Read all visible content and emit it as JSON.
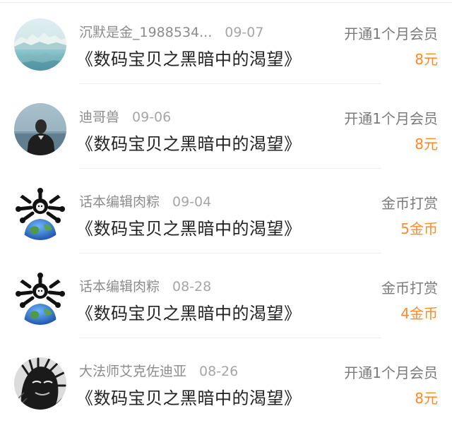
{
  "records": [
    {
      "username": "沉默是金_1988534...",
      "date": "09-07",
      "title": "《数码宝贝之黑暗中的渴望》",
      "action": "开通1个月会员",
      "amount": "8元",
      "avatar_icon": "landscape-avatar-icon"
    },
    {
      "username": "迪哥兽",
      "date": "09-06",
      "title": "《数码宝贝之黑暗中的渴望》",
      "action": "开通1个月会员",
      "amount": "8元",
      "avatar_icon": "person-seascape-avatar-icon"
    },
    {
      "username": "话本编辑肉粽",
      "date": "09-04",
      "title": "《数码宝贝之黑暗中的渴望》",
      "action": "金币打赏",
      "amount": "5金币",
      "avatar_icon": "globe-creature-avatar-icon"
    },
    {
      "username": "话本编辑肉粽",
      "date": "08-28",
      "title": "《数码宝贝之黑暗中的渴望》",
      "action": "金币打赏",
      "amount": "4金币",
      "avatar_icon": "globe-creature-avatar-icon"
    },
    {
      "username": "大法师艾克佐迪亚",
      "date": "08-26",
      "title": "《数码宝贝之黑暗中的渴望》",
      "action": "开通1个月会员",
      "amount": "8元",
      "avatar_icon": "manga-sketch-avatar-icon"
    }
  ],
  "colors": {
    "amount": "#ff8a2a",
    "meta": "#8c8c8c",
    "title": "#222222"
  }
}
